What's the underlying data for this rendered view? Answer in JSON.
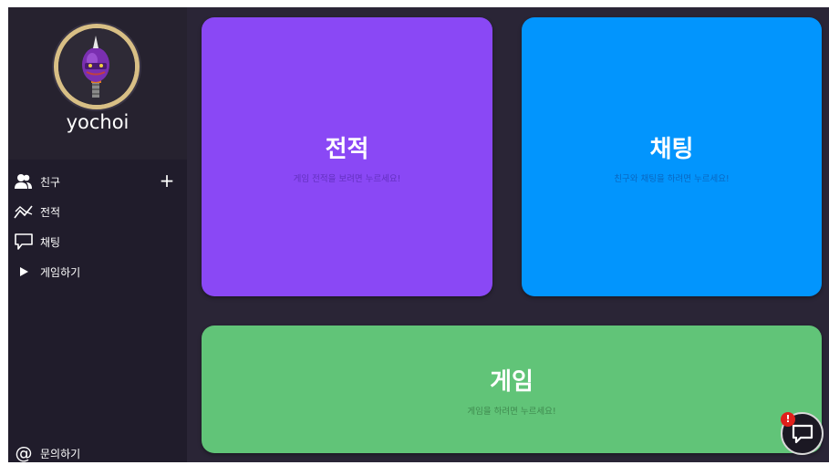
{
  "sidebar": {
    "username": "yochoi",
    "nav": {
      "friends": "친구",
      "record": "전적",
      "chat": "채팅",
      "play": "게임하기"
    },
    "add_friend_symbol": "+",
    "contact": "문의하기"
  },
  "cards": {
    "record": {
      "title": "전적",
      "subtitle": "게임 전적을 보려면 누르세요!"
    },
    "chat": {
      "title": "채팅",
      "subtitle": "친구와 채팅을 하려면 누르세요!"
    },
    "game": {
      "title": "게임",
      "subtitle": "게임을 하려면 누르세요!"
    }
  },
  "chat_fab": {
    "badge": "!"
  },
  "colors": {
    "record_card": "#8a48f5",
    "chat_card": "#0295fd",
    "game_card": "#61c478",
    "sidebar": "#201c2b",
    "background": "#2a2536"
  }
}
